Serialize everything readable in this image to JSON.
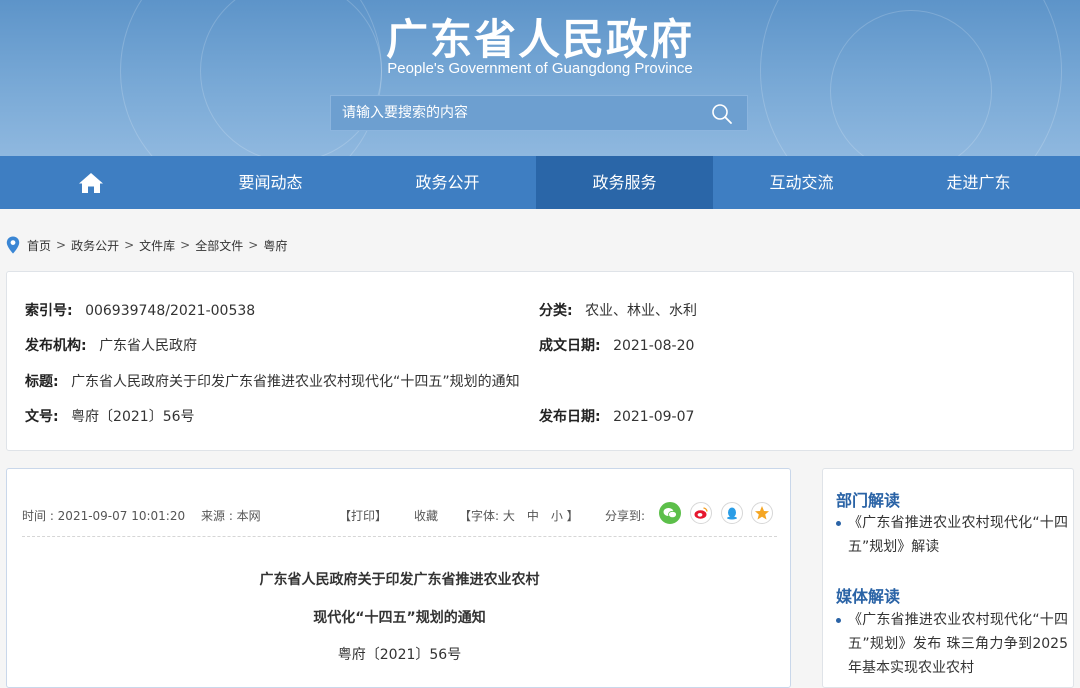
{
  "header": {
    "title": "广东省人民政府",
    "subtitle": "People's Government of Guangdong Province",
    "search_placeholder": "请输入要搜索的内容"
  },
  "nav": {
    "home_icon": "home-icon",
    "items": [
      "要闻动态",
      "政务公开",
      "政务服务",
      "互动交流",
      "走进广东"
    ],
    "active_index": 2
  },
  "breadcrumb": [
    "首页",
    "政务公开",
    "文件库",
    "全部文件",
    "粤府"
  ],
  "info": {
    "index_label": "索引号:",
    "index_value": "006939748/2021-00538",
    "category_label": "分类:",
    "category_value": "农业、林业、水利",
    "issuer_label": "发布机构:",
    "issuer_value": "广东省人民政府",
    "date_written_label": "成文日期:",
    "date_written_value": "2021-08-20",
    "title_label": "标题:",
    "title_value": "广东省人民政府关于印发广东省推进农业农村现代化“十四五”规划的通知",
    "doc_no_label": "文号:",
    "doc_no_value": "粤府〔2021〕56号",
    "publish_label": "发布日期:",
    "publish_value": "2021-09-07"
  },
  "article": {
    "time": "时间 : 2021-09-07 10:01:20",
    "source": "来源 : 本网",
    "print": "【打印】",
    "favorite": "收藏",
    "font_size": "【字体: 大　中　小 】",
    "share": "分享到:",
    "title_line1": "广东省人民政府关于印发广东省推进农业农村",
    "title_line2": "现代化“十四五”规划的通知",
    "doc_no": "粤府〔2021〕56号"
  },
  "sidebar": {
    "dept_heading": "部门解读",
    "dept_link": "《广东省推进农业农村现代化“十四五”规划》解读",
    "media_heading": "媒体解读",
    "media_link": "《广东省推进农业农村现代化“十四五”规划》发布 珠三角力争到2025年基本实现农业农村"
  },
  "colors": {
    "nav_bg": "#3e7ec2",
    "nav_active": "#2a66a8",
    "heading_blue": "#2a63a6"
  }
}
